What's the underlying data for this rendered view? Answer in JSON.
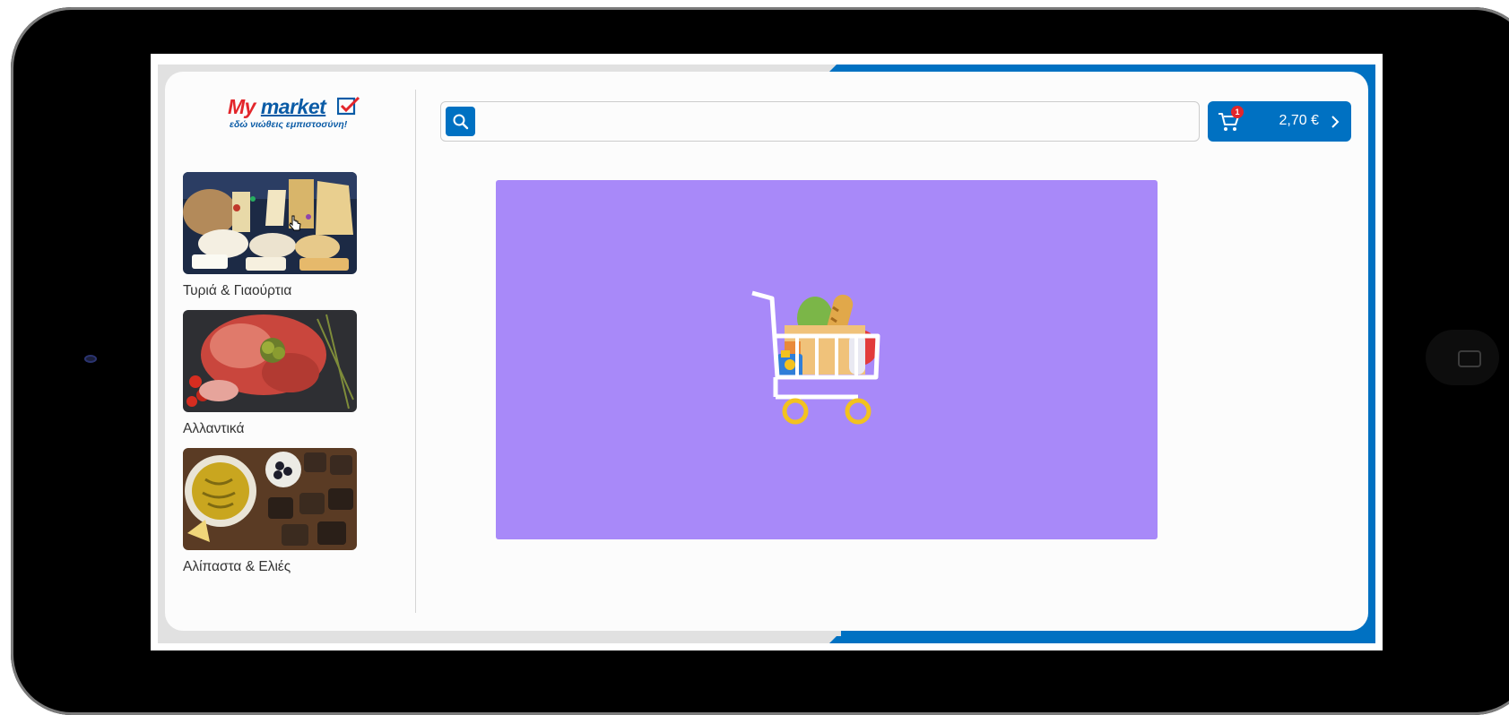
{
  "logo": {
    "brand_my": "My",
    "brand_market": "market",
    "tagline": "εδώ νιώθεις εμπιστοσύνη!"
  },
  "categories": [
    {
      "label": "Τυριά & Γιαούρτια",
      "icon": "cheese-photo"
    },
    {
      "label": "Αλλαντικά",
      "icon": "cold-cuts-photo"
    },
    {
      "label": "Αλίπαστα & Ελιές",
      "icon": "pickled-olives-photo"
    }
  ],
  "search": {
    "placeholder": "",
    "value": "",
    "icon": "search-icon"
  },
  "cart": {
    "count": "1",
    "total": "2,70 €",
    "icon": "cart-icon"
  },
  "banner": {
    "illustration": "grocery-cart-illustration"
  },
  "colors": {
    "accent": "#0071c2",
    "banner": "#a889f9",
    "brand_red": "#e3262b"
  }
}
